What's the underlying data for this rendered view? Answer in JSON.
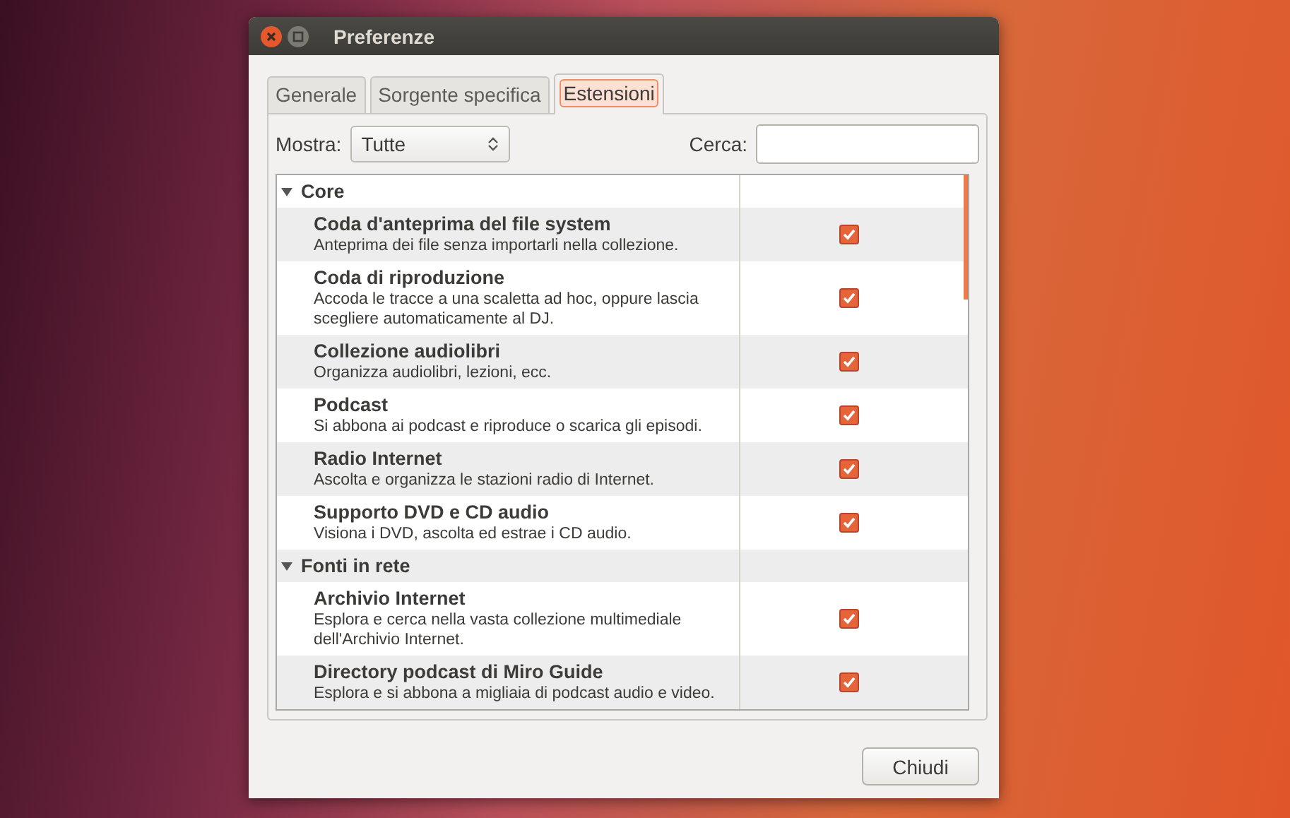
{
  "window": {
    "title": "Preferenze"
  },
  "tabs": [
    {
      "label": "Generale",
      "selected": false
    },
    {
      "label": "Sorgente specifica",
      "selected": false
    },
    {
      "label": "Estensioni",
      "selected": true
    }
  ],
  "filter": {
    "label": "Mostra:",
    "value": "Tutte"
  },
  "search": {
    "label": "Cerca:"
  },
  "groups": [
    {
      "name": "Core",
      "expanded": true,
      "children": [
        {
          "name": "Coda d'anteprima del file system",
          "description": "Anteprima dei file senza importarli nella collezione.",
          "checked": true
        },
        {
          "name": "Coda di riproduzione",
          "description": "Accoda le tracce a una scaletta ad hoc, oppure lascia\nscegliere automaticamente al DJ.",
          "checked": true
        },
        {
          "name": "Collezione audiolibri",
          "description": "Organizza audiolibri, lezioni, ecc.",
          "checked": true
        },
        {
          "name": "Podcast",
          "description": "Si abbona ai podcast e riproduce o scarica gli episodi.",
          "checked": true
        },
        {
          "name": "Radio Internet",
          "description": "Ascolta e organizza le stazioni radio di Internet.",
          "checked": true
        },
        {
          "name": "Supporto DVD e CD audio",
          "description": "Visiona i DVD, ascolta ed estrae i CD audio.",
          "checked": true
        }
      ]
    },
    {
      "name": "Fonti in rete",
      "expanded": true,
      "children": [
        {
          "name": "Archivio Internet",
          "description": "Esplora e cerca nella vasta collezione multimediale\ndell'Archivio Internet.",
          "checked": true
        },
        {
          "name": "Directory podcast di Miro Guide",
          "description": "Esplora e si abbona a migliaia di podcast audio e video.",
          "checked": true
        }
      ]
    }
  ],
  "buttons": [
    "Chiudi"
  ]
}
